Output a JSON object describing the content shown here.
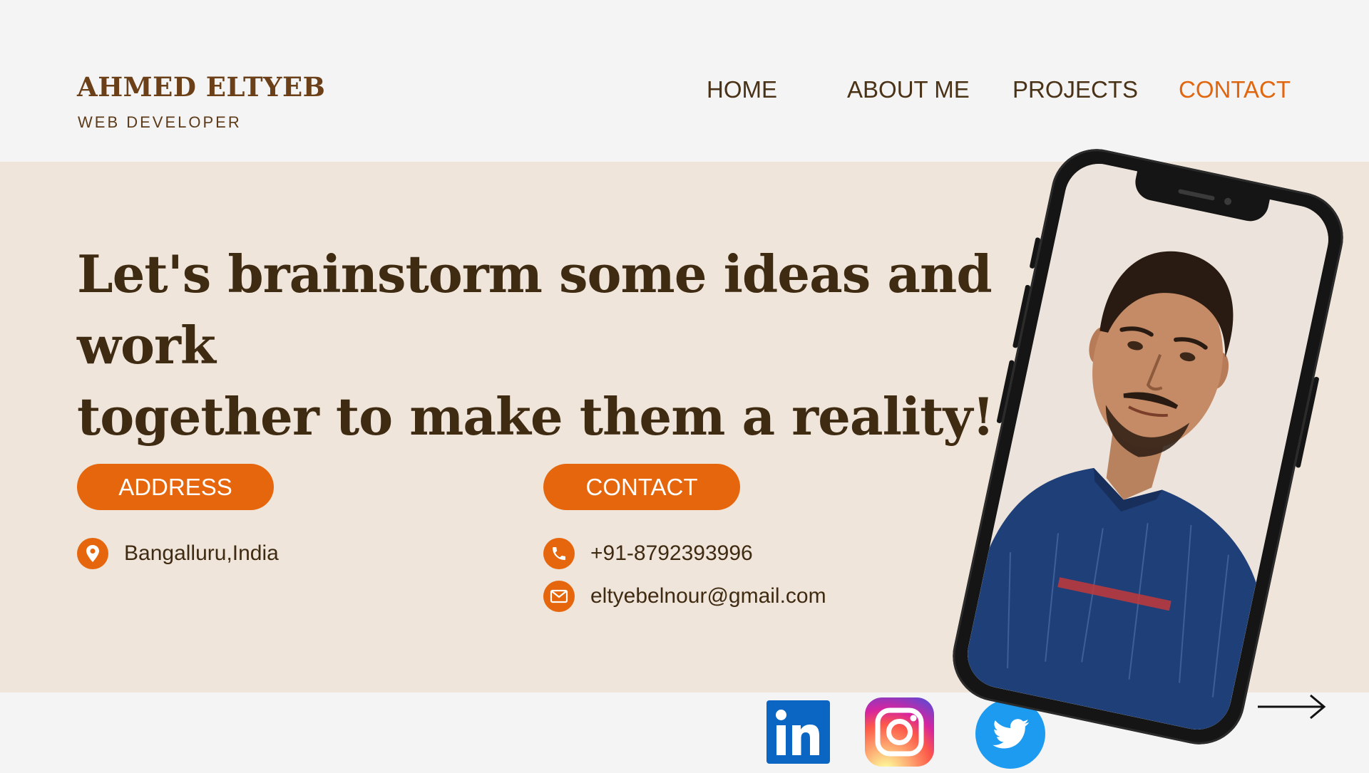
{
  "brand": {
    "name": "AHMED ELTYEB",
    "role": "WEB DEVELOPER"
  },
  "nav": {
    "items": [
      {
        "label": "HOME"
      },
      {
        "label": "ABOUT ME"
      },
      {
        "label": "PROJECTS"
      },
      {
        "label": "CONTACT",
        "active": true
      }
    ]
  },
  "hero": {
    "line1": "Let's brainstorm some ideas and work",
    "line2": "together to make them a reality!"
  },
  "address": {
    "label": "ADDRESS",
    "location": "Bangalluru,India",
    "icon": "location-pin-icon"
  },
  "contact": {
    "label": "CONTACT",
    "phone": "+91-8792393996",
    "email": "eltyebelnour@gmail.com",
    "phone_icon": "phone-icon",
    "email_icon": "envelope-icon"
  },
  "social": [
    "linkedin-icon",
    "instagram-icon",
    "twitter-icon"
  ],
  "colors": {
    "accent": "#e5660c",
    "brand": "#6b3f17",
    "heading": "#3f2a12",
    "band": "#efe5da",
    "background": "#f4f4f4"
  }
}
